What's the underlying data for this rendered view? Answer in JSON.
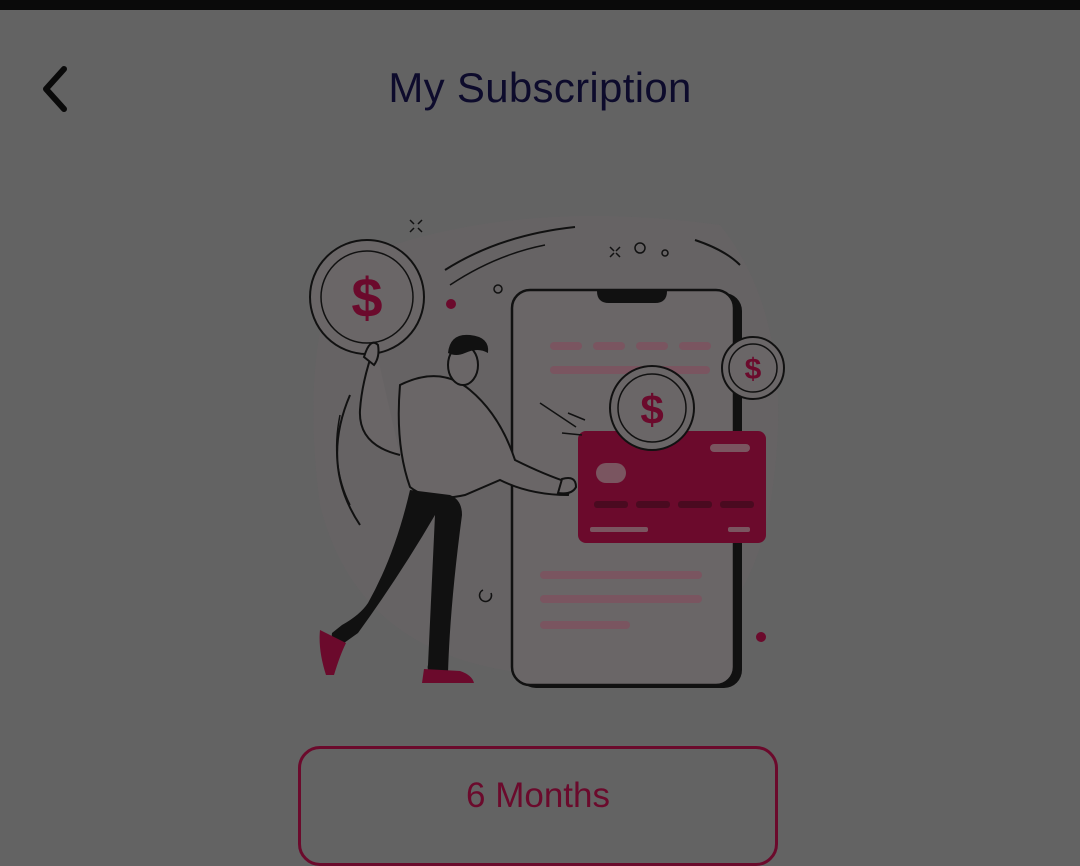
{
  "header": {
    "title": "My Subscription",
    "back_icon": "chevron-left-icon"
  },
  "illustration": {
    "subject": "person-holding-coin-with-phone-and-credit-card",
    "coin_symbol": "$",
    "accent_color": "#6b0a2c"
  },
  "plan": {
    "label": "6 Months"
  },
  "colors": {
    "overlay_background": "#636363",
    "title": "#0d0b2c",
    "accent": "#6b0a2c",
    "status_bar": "#0a0a0a"
  }
}
